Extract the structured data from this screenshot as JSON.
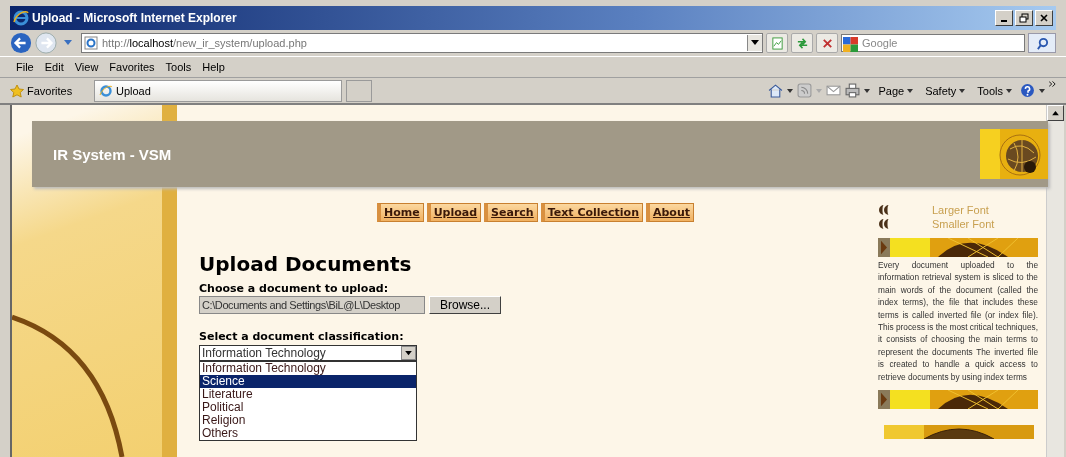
{
  "window": {
    "title": "Upload - Microsoft Internet Explorer"
  },
  "address_bar": {
    "url": "http://**localhost**/new_ir_system/upload.php"
  },
  "search": {
    "placeholder": "Google"
  },
  "menu": [
    "File",
    "Edit",
    "View",
    "Favorites",
    "Tools",
    "Help"
  ],
  "favorites_bar": {
    "label": "Favorites",
    "tab": "Upload"
  },
  "command_bar": [
    "Page",
    "Safety",
    "Tools"
  ],
  "site": {
    "title": "IR System - VSM"
  },
  "nav": [
    "Home",
    "Upload",
    "Search",
    "Text Collection",
    "About"
  ],
  "form": {
    "heading": "Upload Documents",
    "file_label": "Choose a document to upload:",
    "file_value": "C:\\Documents and Settings\\BiL@L\\Desktop",
    "browse": "Browse...",
    "class_label": "Select a document classification:",
    "select_value": "Information Technology",
    "options": [
      {
        "label": "Information Technology",
        "selected": false
      },
      {
        "label": "Science",
        "selected": true
      },
      {
        "label": "Literature",
        "selected": false
      },
      {
        "label": "Political",
        "selected": false
      },
      {
        "label": "Religion",
        "selected": false
      },
      {
        "label": "Others",
        "selected": false
      }
    ]
  },
  "sidebar": {
    "links": [
      "Larger Font",
      "Smaller Font"
    ],
    "text": "Every document uploaded to the information retrieval system is sliced to the main words of the document (called the index terms), the file that includes these terms is called inverted file (or index file). This process is the most critical techniques, it consists of choosing the main terms to represent the documents The inverted file is created to handle a quick access to retrieve documents by using index terms"
  }
}
